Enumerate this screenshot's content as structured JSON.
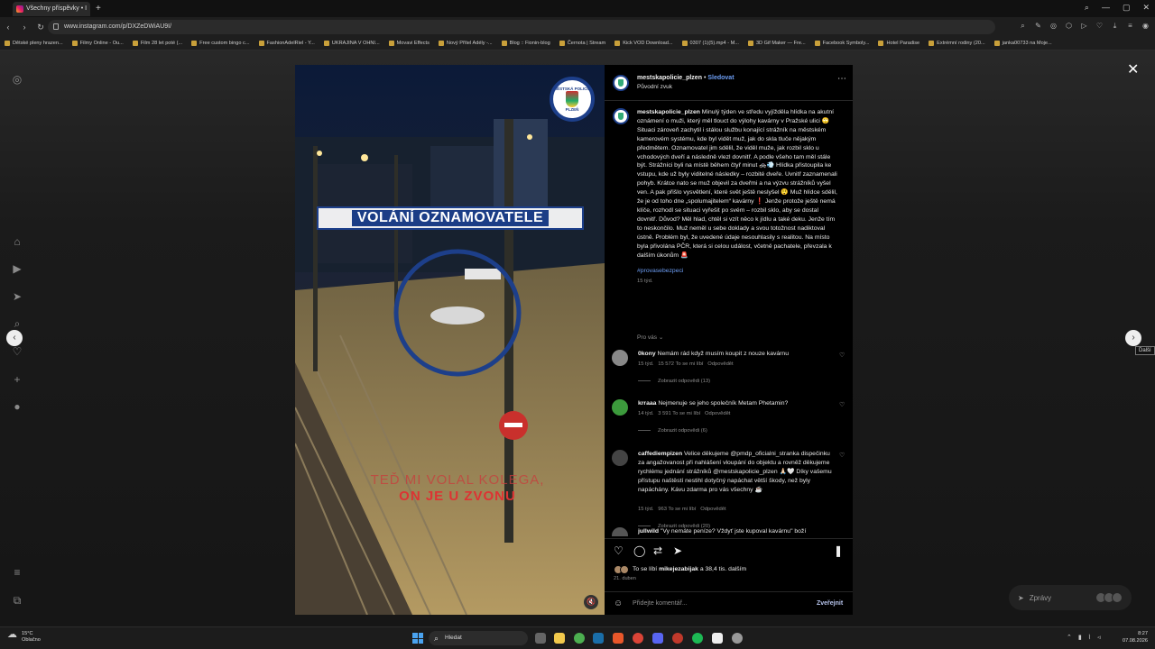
{
  "browser": {
    "tab_title": "Všechny příspěvky • I",
    "url": "www.instagram.com/p/DXZeDWiAU9I/",
    "bookmarks": [
      "Dětské pleny hrazen...",
      "Filmy Online - Ou...",
      "Film 28 let poté (...",
      "Free custom bingo c...",
      "FashionAdelRiel - Y...",
      "UKRAJINA V OHNI...",
      "Movavi Effects",
      "Nový Přítel Adély -...",
      "Blog :: Fionin-blog",
      "Černota | Stream",
      "Kick VOD Download...",
      "0307 (1)(5).mp4 - M...",
      "3D Gif Maker — Fre...",
      "Facebook Symboly...",
      "Hotel Paradise",
      "Extrémní rodiny (20...",
      "janka00733 na Moje..."
    ]
  },
  "video": {
    "banner": "VOLÁNÍ OZNAMOVATELE",
    "subtitle_line1": "TEĎ MI VOLAL KOLEGA,",
    "subtitle_line2": "ON JE U ZVONU",
    "badge_top": "MĚSTSKÁ POLICIE",
    "badge_bottom": "PLZEŇ"
  },
  "post": {
    "username": "mestskapolicie_plzen",
    "separator": "•",
    "follow_label": "Sledovat",
    "audio": "Původní zvuk",
    "caption_author": "mestskapolicie_plzen",
    "caption": "Minulý týden ve středu vyjížděla hlídka na akutní oznámení o muži, který měl tlouct do výlohy kavárny v Pražské ulici 🙄 Situaci zároveň zachytil i stálou službu konající strážník na městském kamerovém systému, kde byl vidět muž, jak do skla tluče nějakým předmětem. Oznamovatel jim sdělil, že viděl muže, jak rozbil sklo u vchodových dveří a následně vlezl dovnitř. A podle všeho tam měl stále být. Strážníci byli na místě během čtyř minut 🚓💨 Hlídka přistoupila ke vstupu, kde už byly viditelné následky – rozbité dveře. Uvnitř zaznamenali pohyb. Krátce nato se muž objevil za dveřmi a na výzvu strážníků vyšel ven. A pak přišlo vysvětlení, které svět ještě neslyšel 😲 Muž hlídce sdělil, že je od toho dne „spolumajitelem“ kavárny ❗ Jenže protože ještě nemá klíče, rozhodl se situaci vyřešit po svém – rozbil sklo, aby se dostal dovnitř. Důvod? Měl hlad, chtěl si vzít něco k jídlu a také deku. Jenže tím to neskončilo. Muž neměl u sebe doklady a svou totožnost nadiktoval ústně. Problém byl, že uvedené údaje nesouhlasily s realitou. Na místo byla přivolána PČR, která si celou událost, včetně pachatele, převzala k dalším úkonům 🚨",
    "hashtag": "#provasebezpeci",
    "age": "15 týd.",
    "for_you": "Pro vás",
    "comments": [
      {
        "user": "0kony",
        "text": "Nemám rád když musím koupit z nouze kavárnu",
        "age": "15 týd.",
        "likes": "15 572 To se mi líbí",
        "reply": "Odpovědět",
        "view_replies": "Zobrazit odpovědi (13)",
        "color": "#888888"
      },
      {
        "user": "krraaa",
        "text": "Nejmenuje se jeho společník Metam Phetamin?",
        "age": "14 týd.",
        "likes": "3 591 To se mi líbí",
        "reply": "Odpovědět",
        "view_replies": "Zobrazit odpovědi (6)",
        "color": "#3c9a3c"
      },
      {
        "user": "caffediempizen",
        "text": "Velice děkujeme @pmdp_oficialni_stranka dispečinku za angažovanost při nahlášení vloupání do objektu a rovněž děkujeme rychlému jednání strážníků @mestskapolicie_plzen 🙏🏻🤍 Díky vašemu přístupu naštěstí nestihl dotyčný napáchat větší škody, než byly napáchány. Kávu zdarma pro vás všechny ☕",
        "age": "15 týd.",
        "likes": "963 To se mi líbí",
        "reply": "Odpovědět",
        "view_replies": "Zobrazit odpovědi (20)",
        "color": "#444444"
      },
      {
        "user": "jullwild",
        "text": "\"Vy nemáte peníze? Vždyť jste kupoval kavárnu\" boží",
        "color": "#555555"
      }
    ],
    "likes_prefix": "To se líbí",
    "likes_user": "mikejezabijak",
    "likes_suffix": "a 38,4 tis. dalším",
    "date": "21. duben",
    "comment_placeholder": "Přidejte komentář...",
    "publish_label": "Zveřejnit"
  },
  "page": {
    "next_tooltip": "Další",
    "messages_label": "Zprávy"
  },
  "taskbar": {
    "temperature": "15°C",
    "weather": "Oblačno",
    "search_label": "Hledat",
    "time": "8:27",
    "date": "07.08.2026"
  }
}
